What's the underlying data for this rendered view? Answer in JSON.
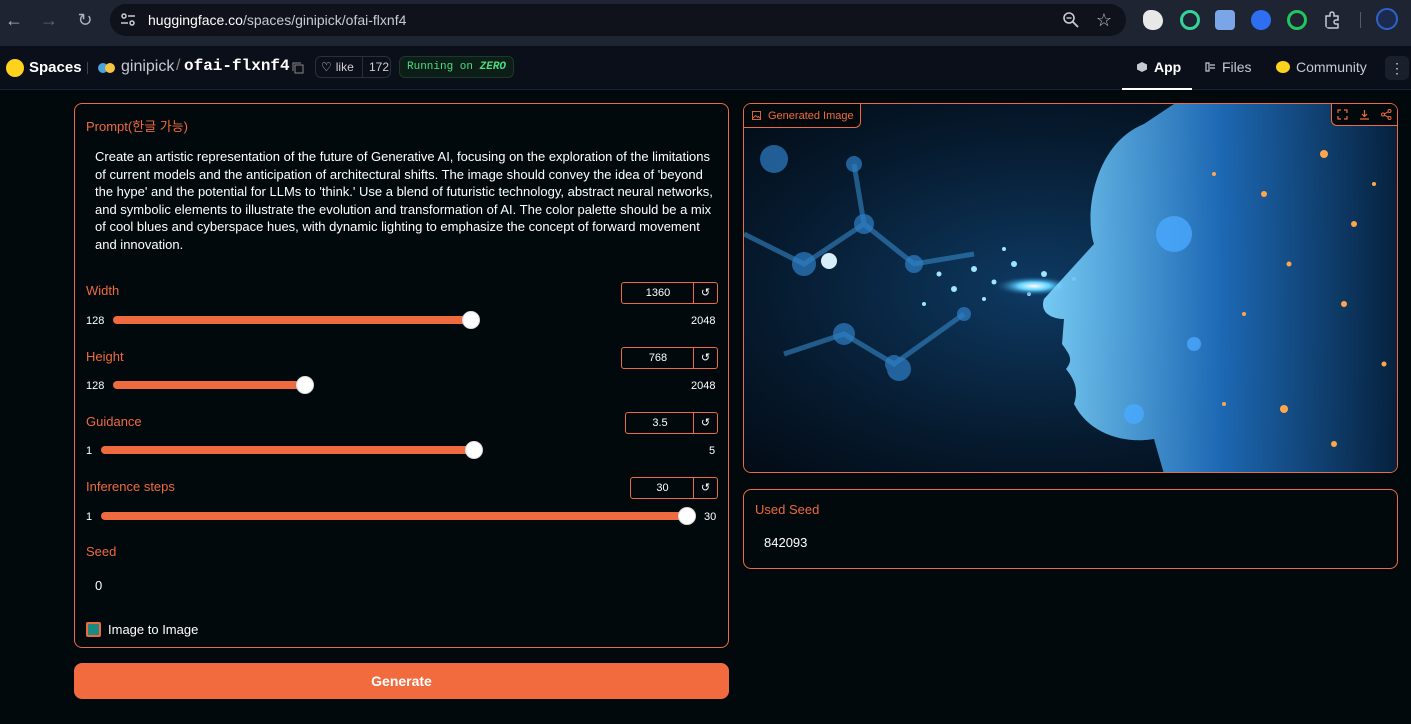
{
  "browser": {
    "url_host": "huggingface.co",
    "url_path": "/spaces/ginipick/ofai-flxnf4"
  },
  "header": {
    "spaces_label": "Spaces",
    "owner": "ginipick",
    "separator": "/",
    "repo": "ofai-flxnf4",
    "like_label": "like",
    "like_count": "172",
    "running_prefix": "Running on",
    "running_hw": "ZERO",
    "tabs": [
      {
        "label": "App",
        "icon": "cube-icon"
      },
      {
        "label": "Files",
        "icon": "files-icon"
      },
      {
        "label": "Community",
        "icon": "community-icon"
      }
    ]
  },
  "form": {
    "prompt_label": "Prompt(한글 가능)",
    "prompt_value": "Create an artistic representation of the future of Generative AI, focusing on the exploration of the limitations of current models and the anticipation of architectural shifts. The image should convey the idea of 'beyond the hype' and the potential for LLMs to 'think.' Use a blend of futuristic technology, abstract neural networks, and symbolic elements to illustrate the evolution and transformation of AI. The color palette should be a mix of cool blues and cyberspace hues, with dynamic lighting to emphasize the concept of forward movement and innovation.",
    "sliders": [
      {
        "label": "Width",
        "value": "1360",
        "min": "128",
        "max": "2048",
        "fraction": 0.6417
      },
      {
        "label": "Height",
        "value": "768",
        "min": "128",
        "max": "2048",
        "fraction": 0.3333
      },
      {
        "label": "Guidance",
        "value": "3.5",
        "min": "1",
        "max": "5",
        "fraction": 0.625
      },
      {
        "label": "Inference steps",
        "value": "30",
        "min": "1",
        "max": "30",
        "fraction": 1.0
      }
    ],
    "reset_glyph": "↺",
    "seed_label": "Seed",
    "seed_value": "0",
    "img2img_label": "Image to Image",
    "generate_label": "Generate"
  },
  "output": {
    "image_label": "Generated Image",
    "used_seed_label": "Used Seed",
    "used_seed_value": "842093"
  },
  "colors": {
    "accent": "#ef6a3e",
    "background": "#02090d",
    "button": "#f26b3e",
    "running": "#4ade80"
  }
}
